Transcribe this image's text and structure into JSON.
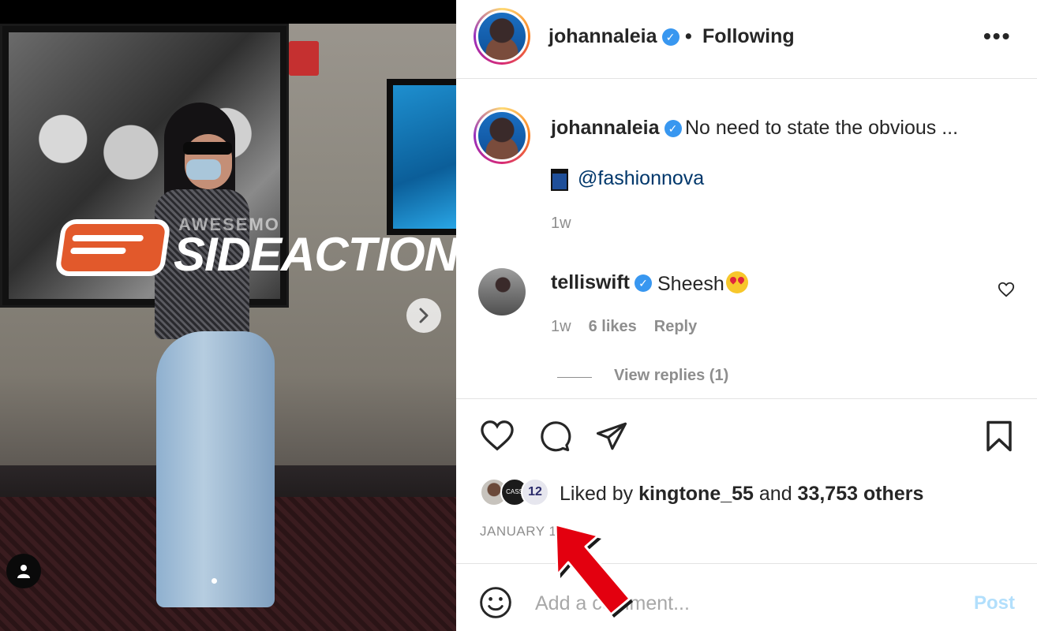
{
  "media": {
    "watermark_small": "AWESEMO",
    "watermark_big": "SIDEACTION",
    "next_icon": "chevron-right-icon",
    "user_tag_icon": "person-icon",
    "dots": 1
  },
  "header": {
    "username": "johannaleia",
    "separator": "•",
    "follow_status": "Following",
    "more_label": "•••"
  },
  "caption": {
    "username": "johannaleia",
    "text": "No need to state the obvious ...",
    "mention": "@fashionnova",
    "time": "1w"
  },
  "comment": {
    "username": "telliswift",
    "text": "Sheesh",
    "time": "1w",
    "likes": "6 likes",
    "reply": "Reply",
    "view_replies": "View replies (1)"
  },
  "actions": {
    "like_icon": "heart-icon",
    "comment_icon": "comment-icon",
    "share_icon": "send-icon",
    "save_icon": "bookmark-icon"
  },
  "likes": {
    "prefix": "Liked by ",
    "user": "kingtone_55",
    "middle": " and ",
    "others": "33,753 others",
    "avatar2_text": "CASS ATHE",
    "avatar3_text": "12"
  },
  "date": "JANUARY 1",
  "add_comment": {
    "placeholder": "Add a comment...",
    "post_label": "Post"
  },
  "colors": {
    "verified": "#3897f0",
    "post_disabled": "#b2dffc",
    "mention": "#00376b",
    "arrow": "#e3000f"
  }
}
